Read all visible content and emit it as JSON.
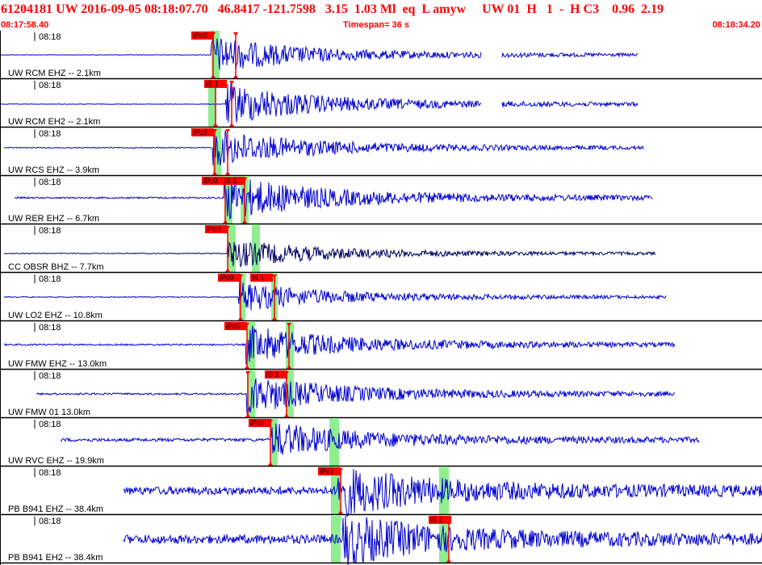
{
  "header": {
    "event_line": "61204181 UW 2016-09-05 08:18:07.70   46.8417 -121.7598   3.15  1.03 Ml  eq  L amyw     UW 01  H   1  -  H C3    0.96  2.19",
    "start_time": "08:17:58.40",
    "timespan": "Timespan=  36 s",
    "end_time": "08:18:34.20"
  },
  "colors": {
    "header_text": "#ff0000",
    "trace": "#0000d0",
    "trace_alt": "#000060",
    "pick_window": "#90ee90",
    "pick_label_bg": "#ff0000",
    "pick_line": "#ff0000"
  },
  "panels": [
    {
      "station": "UW RCM EHZ -- 2.1km",
      "time_label": "08:18",
      "picks": [
        "iPc0"
      ],
      "color": "trace"
    },
    {
      "station": "UW RCM EH2 -- 2.1km",
      "time_label": "08:18",
      "picks": [
        "iS 1"
      ],
      "color": "trace"
    },
    {
      "station": "UW RCS EHZ -- 3.9km",
      "time_label": "08:18",
      "picks": [
        "iPc0"
      ],
      "color": "trace"
    },
    {
      "station": "UW RER EHZ -- 6.7km",
      "time_label": "08:18",
      "picks": [
        "iPc0",
        "iS 1"
      ],
      "color": "trace"
    },
    {
      "station": "CC OBSR BHZ -- 7.7km",
      "time_label": "08:18",
      "picks": [
        "iPc0"
      ],
      "color": "trace_alt"
    },
    {
      "station": "UW LO2 EHZ -- 10.8km",
      "time_label": "08:18",
      "picks": [
        "iPc0",
        "iS 1"
      ],
      "color": "trace"
    },
    {
      "station": "UW FMW EHZ -- 13.0km",
      "time_label": "08:18",
      "picks": [
        "iPc0"
      ],
      "color": "trace"
    },
    {
      "station": "UW FMW 01 13.0km",
      "time_label": "08:18",
      "picks": [
        "iS 1"
      ],
      "color": "trace"
    },
    {
      "station": "UW RVC EHZ -- 19.9km",
      "time_label": "08:18",
      "picks": [
        "iPc0"
      ],
      "color": "trace"
    },
    {
      "station": "PB B941 EHZ -- 38.4km",
      "time_label": "08:18",
      "picks": [
        "iPc1"
      ],
      "color": "trace"
    },
    {
      "station": "PB B941 EH2 -- 38.4km",
      "time_label": "08:18",
      "picks": [
        "iS 1"
      ],
      "color": "trace"
    }
  ]
}
